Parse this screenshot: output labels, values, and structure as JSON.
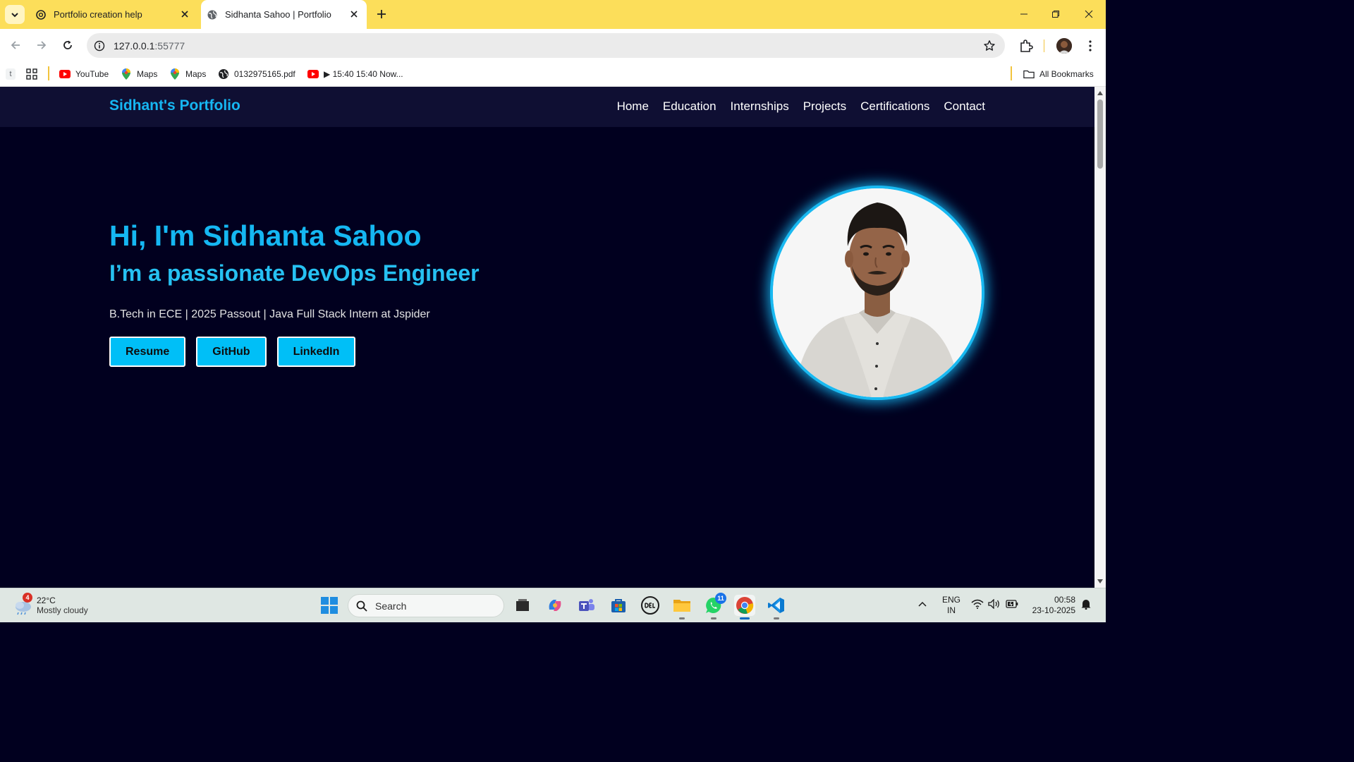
{
  "browser": {
    "tabs": [
      {
        "title": "Portfolio creation help",
        "active": false,
        "icon": "openai-icon"
      },
      {
        "title": "Sidhanta Sahoo | Portfolio",
        "active": true,
        "icon": "globe-icon"
      }
    ],
    "url_host": "127.0.0.1",
    "url_port": ":55777",
    "bookmarks": [
      {
        "label": "YouTube",
        "icon": "youtube-icon"
      },
      {
        "label": "Maps",
        "icon": "maps-icon"
      },
      {
        "label": "Maps",
        "icon": "maps-icon"
      },
      {
        "label": "0132975165.pdf",
        "icon": "globe-icon"
      },
      {
        "label": "▶ 15:40 15:40 Now...",
        "icon": "youtube-icon"
      }
    ],
    "all_bookmarks_label": "All Bookmarks",
    "t_label": "t"
  },
  "site": {
    "brand": "Sidhant's Portfolio",
    "nav": [
      "Home",
      "Education",
      "Internships",
      "Projects",
      "Certifications",
      "Contact"
    ],
    "hero": {
      "title": "Hi, I'm Sidhanta Sahoo",
      "subtitle": "I’m a passionate DevOps Engineer",
      "tagline": "B.Tech in ECE | 2025 Passout | Java Full Stack Intern at Jspider",
      "buttons": [
        "Resume",
        "GitHub",
        "LinkedIn"
      ]
    },
    "colors": {
      "background": "#01001f",
      "navbar": "#0f0f33",
      "accent": "#16b6f2",
      "button": "#00bff7"
    }
  },
  "taskbar": {
    "weather": {
      "badge": "4",
      "temp": "22°C",
      "condition": "Mostly cloudy"
    },
    "search_placeholder": "Search",
    "whatsapp_badge": "11",
    "lang_line1": "ENG",
    "lang_line2": "IN",
    "time": "00:58",
    "date": "23-10-2025"
  }
}
